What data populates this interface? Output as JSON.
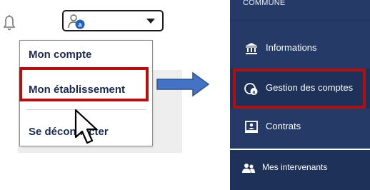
{
  "header": {
    "bell_icon": "bell-icon",
    "user_icon": "user-account-icon",
    "caret_icon": "caret-down-icon"
  },
  "dropdown": {
    "items": [
      "Mon compte",
      "Mon établissement",
      "Se déconnecter"
    ]
  },
  "sidebar": {
    "title": "COMMUNE",
    "items": [
      {
        "label": "Informations",
        "icon": "institution-icon"
      },
      {
        "label": "Gestion des comptes",
        "icon": "account-management-icon"
      },
      {
        "label": "Contrats",
        "icon": "contract-icon"
      },
      {
        "label": "Mes intervenants",
        "icon": "people-icon"
      }
    ]
  },
  "colors": {
    "sidebar_bg": "#253a66",
    "highlight": "#b40f10",
    "arrow": "#4472c4",
    "menu_text": "#1b2a4e"
  }
}
